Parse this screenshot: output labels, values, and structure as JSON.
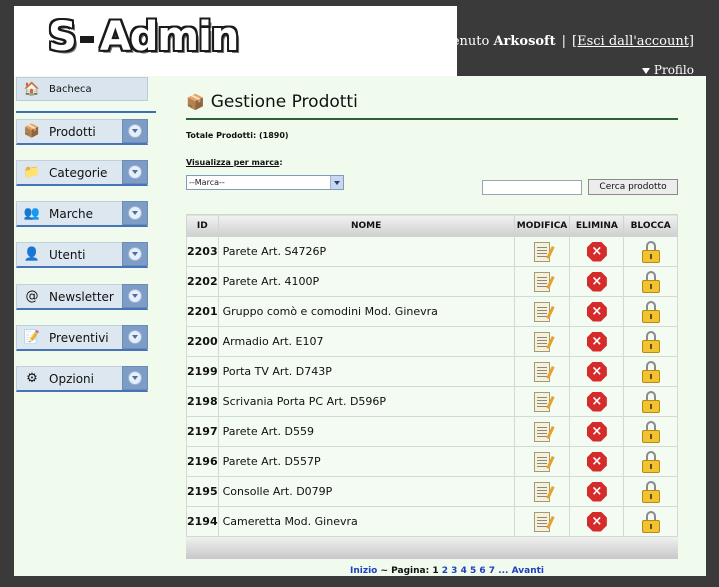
{
  "header": {
    "logo_part1": "S",
    "logo_part2": "Admin",
    "welcome_prefix": "Benvenuto",
    "username": "Arkosoft",
    "separator": "|",
    "logout_label": "[Esci dall'account]",
    "profile_label": "Profilo"
  },
  "sidebar": {
    "home": {
      "label": "Bacheca",
      "icon": "home-icon"
    },
    "items": [
      {
        "label": "Prodotti",
        "icon": "products-icon"
      },
      {
        "label": "Categorie",
        "icon": "folder-icon"
      },
      {
        "label": "Marche",
        "icon": "users-icon"
      },
      {
        "label": "Utenti",
        "icon": "user-icon"
      },
      {
        "label": "Newsletter",
        "icon": "newsletter-icon"
      },
      {
        "label": "Preventivi",
        "icon": "quote-icon"
      },
      {
        "label": "Opzioni",
        "icon": "options-icon"
      }
    ]
  },
  "main": {
    "title": "Gestione Prodotti",
    "total_label": "Totale Prodotti: (1890)",
    "brand_filter_label": "Visualizza per marca",
    "brand_filter_colon": ":",
    "brand_select_value": "--Marca--",
    "search_value": "",
    "search_button": "Cerca prodotto",
    "table": {
      "headers": [
        "ID",
        "NOME",
        "MODIFICA",
        "ELIMINA",
        "BLOCCA"
      ],
      "rows": [
        {
          "id": "2203",
          "name": "Parete Art. S4726P"
        },
        {
          "id": "2202",
          "name": "Parete Art. 4100P"
        },
        {
          "id": "2201",
          "name": "Gruppo comò e comodini Mod. Ginevra"
        },
        {
          "id": "2200",
          "name": "Armadio Art. E107"
        },
        {
          "id": "2199",
          "name": "Porta TV Art. D743P"
        },
        {
          "id": "2198",
          "name": "Scrivania Porta PC Art. D596P"
        },
        {
          "id": "2197",
          "name": "Parete Art. D559"
        },
        {
          "id": "2196",
          "name": "Parete Art. D557P"
        },
        {
          "id": "2195",
          "name": "Consolle Art. D079P"
        },
        {
          "id": "2194",
          "name": "Cameretta Mod. Ginevra"
        }
      ]
    },
    "pager": {
      "first_label": "Inizio",
      "page_label": "~ Pagina:",
      "current": "1",
      "pages": [
        "2",
        "3",
        "4",
        "5",
        "6",
        "7"
      ],
      "ellipsis": "...",
      "next_label": "Avanti"
    }
  },
  "colors": {
    "page_bg": "#f0fbee",
    "header_dark": "#3a3a3a",
    "sidebar_accent": "#4673b9",
    "title_rule": "#2f5f3a",
    "link": "#1f3fbf",
    "delete_red": "#d52b2b",
    "lock_yellow": "#f1c232"
  }
}
